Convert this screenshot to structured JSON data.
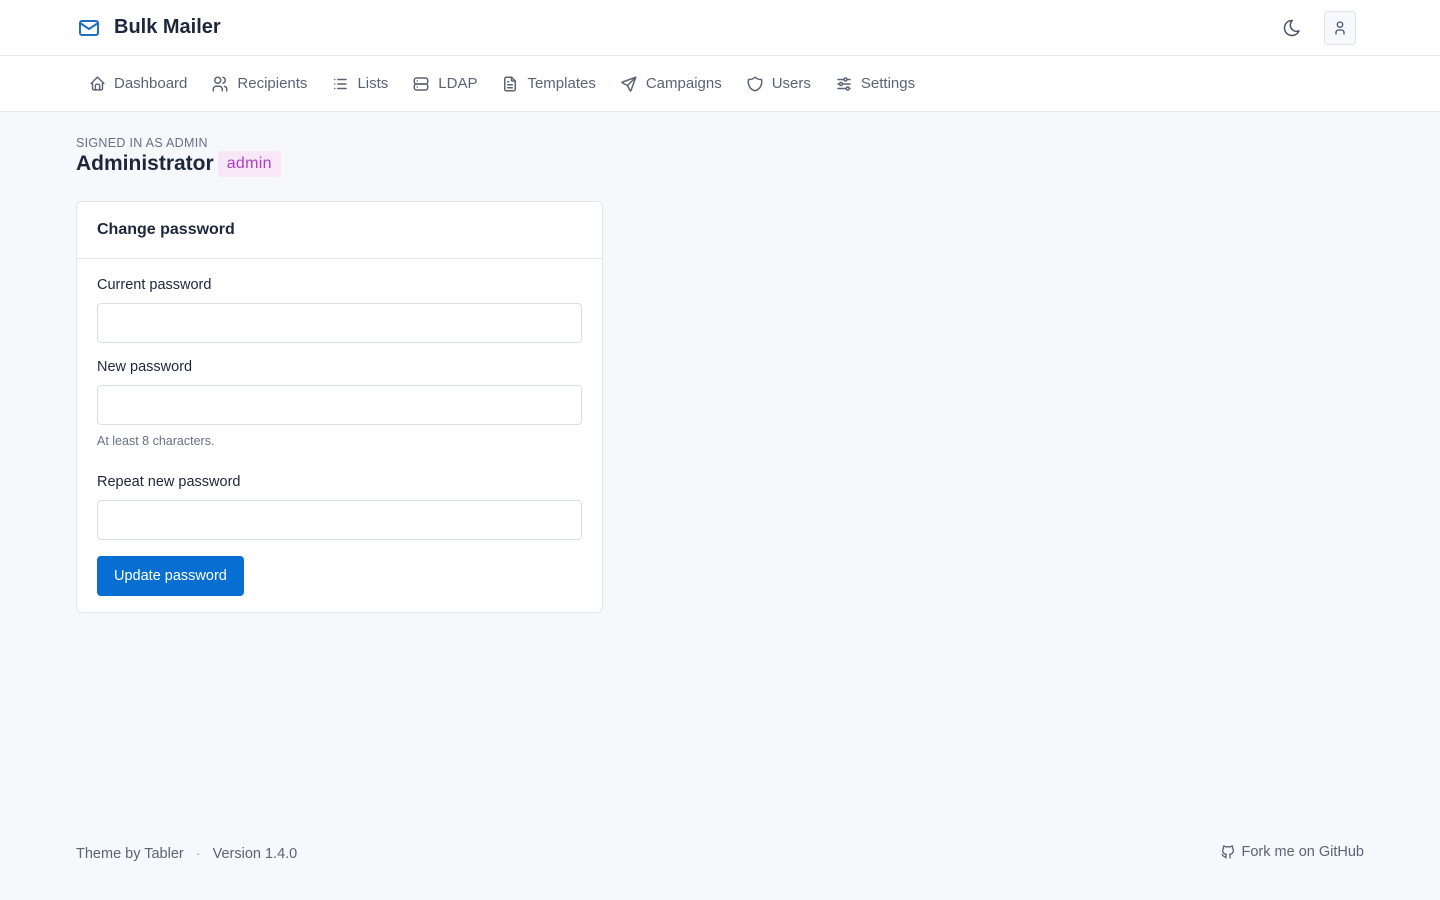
{
  "app": {
    "title": "Bulk Mailer"
  },
  "nav": {
    "items": [
      {
        "label": "Dashboard",
        "icon": "home-icon"
      },
      {
        "label": "Recipients",
        "icon": "users-icon"
      },
      {
        "label": "Lists",
        "icon": "list-icon"
      },
      {
        "label": "LDAP",
        "icon": "server-icon"
      },
      {
        "label": "Templates",
        "icon": "file-text-icon"
      },
      {
        "label": "Campaigns",
        "icon": "send-icon"
      },
      {
        "label": "Users",
        "icon": "shield-icon"
      },
      {
        "label": "Settings",
        "icon": "sliders-icon"
      }
    ]
  },
  "header": {
    "pretitle": "Signed in as admin",
    "title": "Administrator",
    "role_badge": "admin"
  },
  "password_card": {
    "title": "Change password",
    "current_label": "Current password",
    "new_label": "New password",
    "new_hint": "At least 8 characters.",
    "repeat_label": "Repeat new password",
    "submit_label": "Update password"
  },
  "footer": {
    "theme_text": "Theme by Tabler",
    "separator": "·",
    "version": "Version 1.4.0",
    "github_link": "Fork me on GitHub"
  },
  "colors": {
    "primary": "#066fd1",
    "brand": "#1f6fc5",
    "badge_bg": "#f7e7f7",
    "badge_text": "#ae3ec9",
    "page_bg": "#f6f8fb"
  }
}
